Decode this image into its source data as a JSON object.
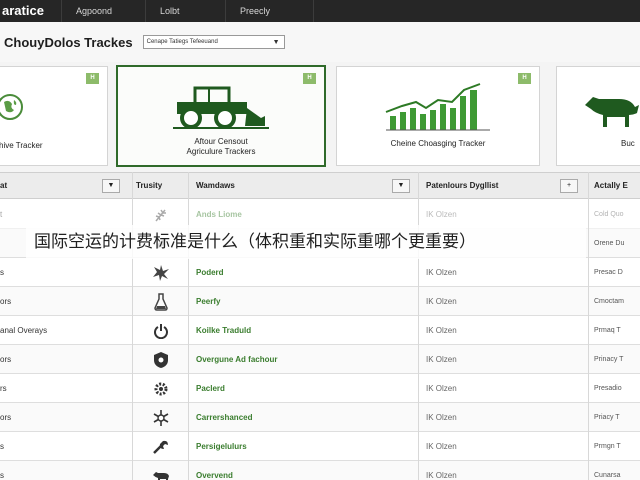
{
  "nav": {
    "brand": "aratice",
    "items": [
      "Agpoond",
      "Lolbt",
      "Preecly"
    ]
  },
  "header": {
    "title": "ChouyDolos Trackes",
    "select_value": "Cenape Tatiegs Tefeeuand"
  },
  "cards": [
    {
      "label": "chive Tracker",
      "badge": "H",
      "icon": "globe-icon"
    },
    {
      "label": "Aftour Censout\nAgriculure Trackers",
      "badge": "H",
      "icon": "tractor-icon"
    },
    {
      "label": "Cheine Choasging Tracker",
      "badge": "H",
      "icon": "bar-chart-icon"
    },
    {
      "label": "Buc",
      "badge": "",
      "icon": "animal-icon"
    }
  ],
  "table": {
    "headers": [
      "at",
      "Trusity",
      "Wamdaws",
      "Patenlours Dygllist",
      "Actally E"
    ],
    "rows": [
      {
        "name": "t",
        "icon": "wheat-icon",
        "ward": "Ands Liome",
        "pat": "IK Olzen",
        "act": "Cold Quo"
      },
      {
        "name": "",
        "icon": "leaf-icon",
        "ward": "",
        "pat": "",
        "act": "Orene Du"
      },
      {
        "name": "s",
        "icon": "burst-icon",
        "ward": "Poderd",
        "pat": "IK Olzen",
        "act": "Presac D"
      },
      {
        "name": "ors",
        "icon": "flask-icon",
        "ward": "Peerfy",
        "pat": "IK Olzen",
        "act": "Cmoctam"
      },
      {
        "name": "anal Overays",
        "icon": "power-icon",
        "ward": "Koilke Traduld",
        "pat": "IK Olzen",
        "act": "Prmaq T"
      },
      {
        "name": "ors",
        "icon": "shield-icon",
        "ward": "Overgune Ad fachour",
        "pat": "IK Olzen",
        "act": "Prinacy T"
      },
      {
        "name": "rs",
        "icon": "gear-icon",
        "ward": "Paclerd",
        "pat": "IK Olzen",
        "act": "Presadio"
      },
      {
        "name": "ors",
        "icon": "snowflake-icon",
        "ward": "Carrershanced",
        "pat": "IK Olzen",
        "act": "Priacy T"
      },
      {
        "name": "s",
        "icon": "wrench-icon",
        "ward": "Persigelulurs",
        "pat": "IK Olzen",
        "act": "Prmgn T"
      },
      {
        "name": "s",
        "icon": "animal-icon",
        "ward": "Overvend",
        "pat": "IK Olzen",
        "act": "Cunarsa"
      }
    ]
  },
  "banner": "国际空运的计费标准是什么（体积重和实际重哪个更重要）",
  "colors": {
    "accent": "#3a7d2e",
    "badge": "#8dbb6a",
    "nav_bg": "#262626"
  }
}
